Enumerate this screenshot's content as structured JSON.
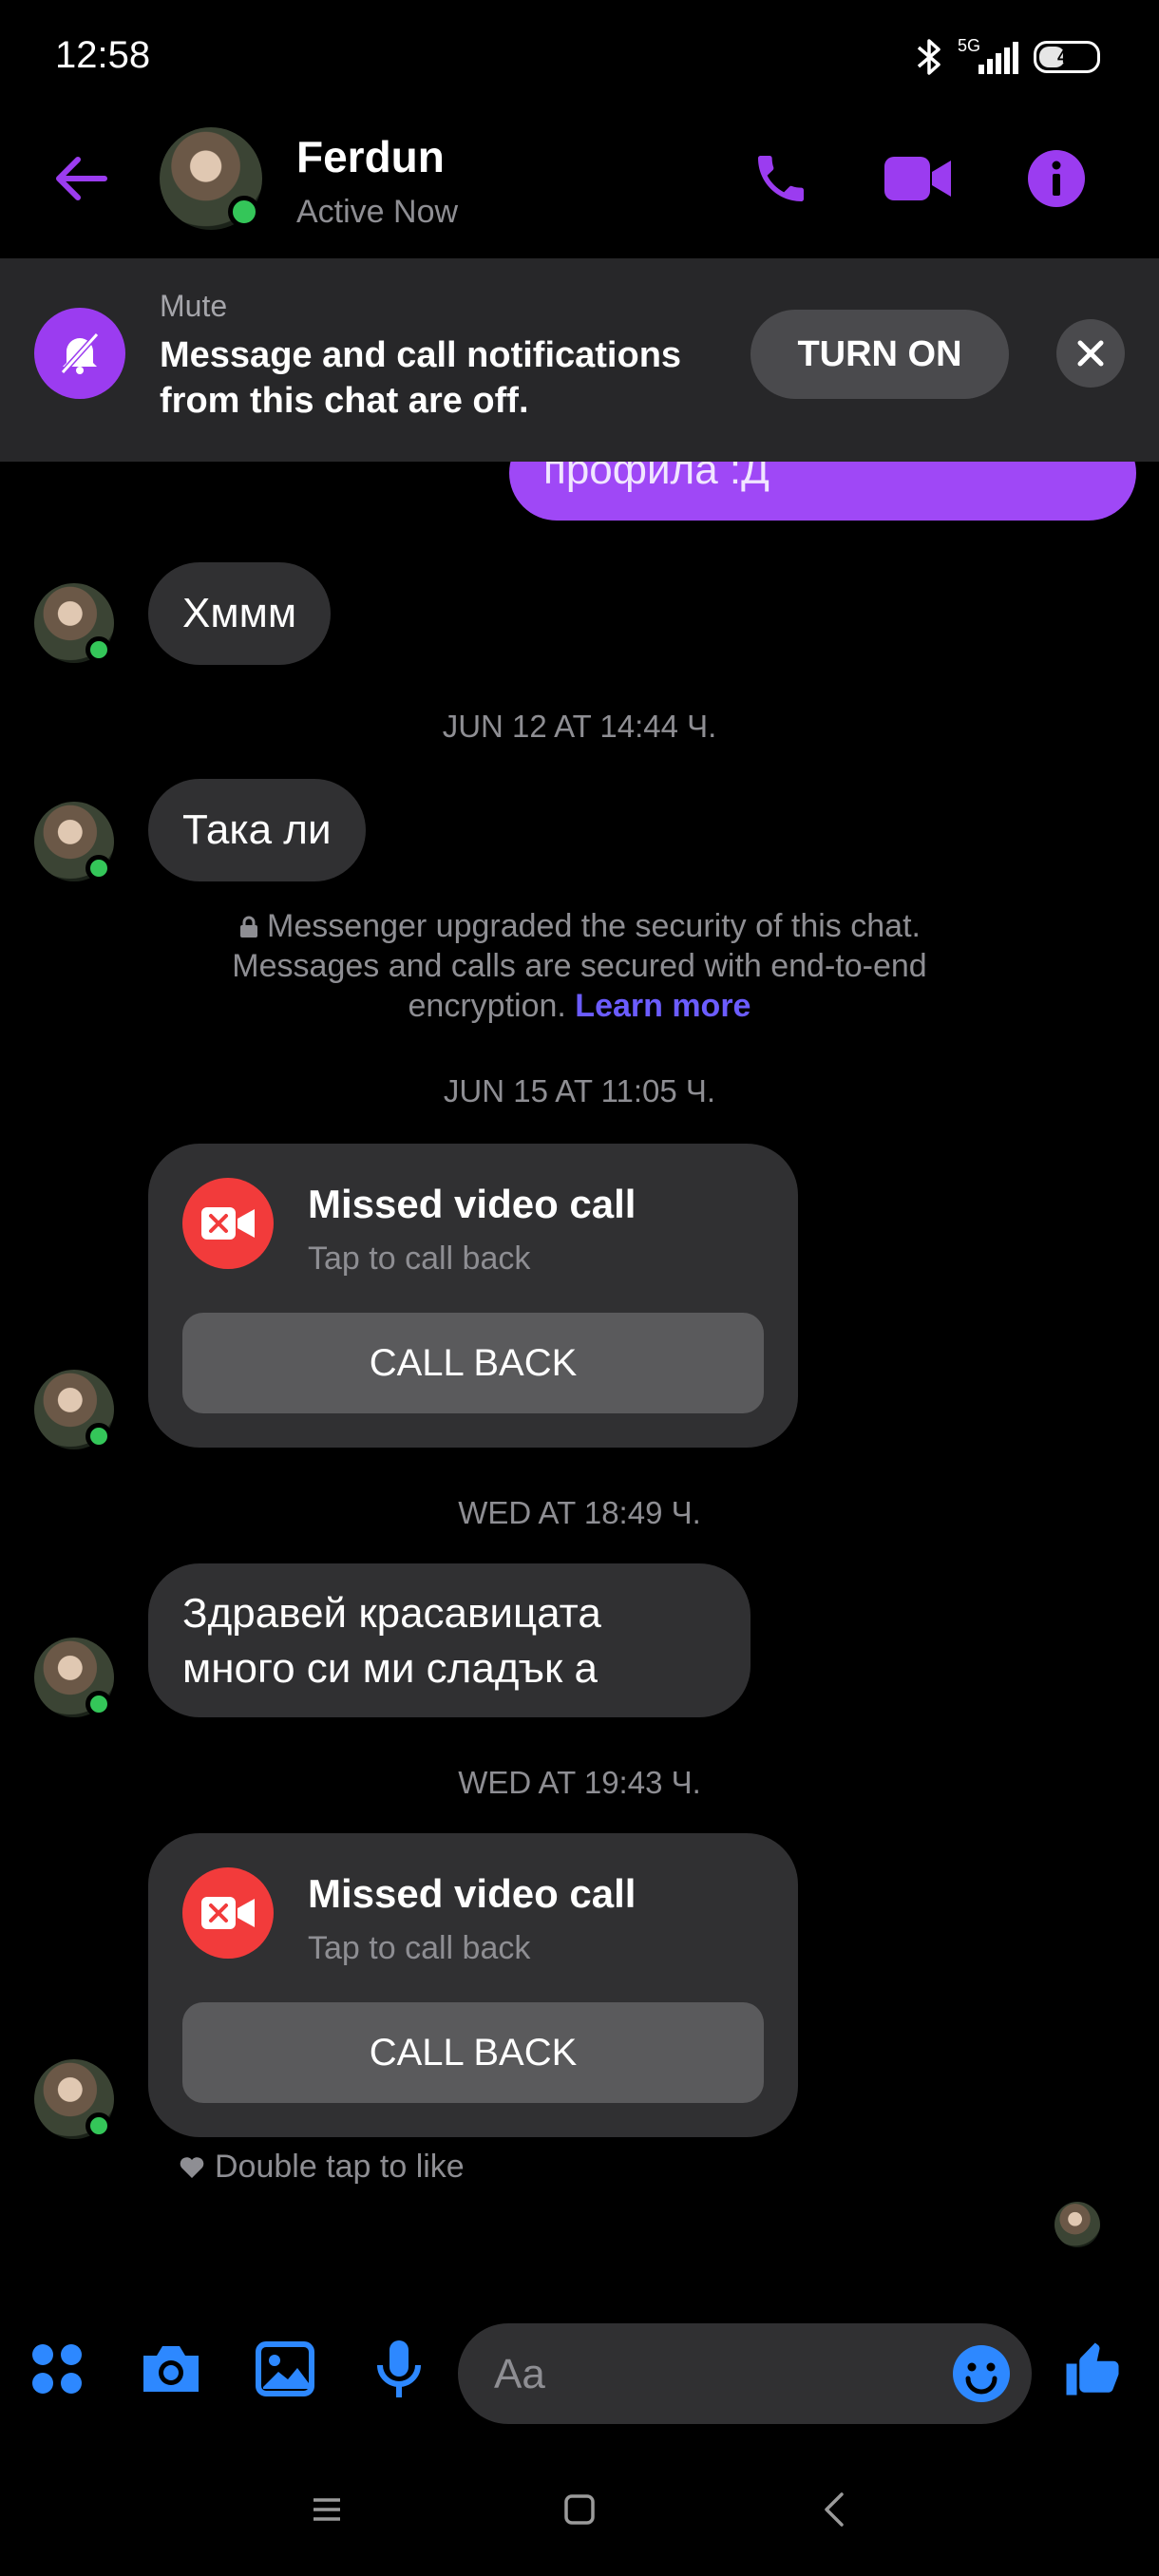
{
  "status_bar": {
    "time": "12:58",
    "network": "5G",
    "battery": "49"
  },
  "header": {
    "name": "Ferdun",
    "status": "Active Now"
  },
  "mute_banner": {
    "title": "Mute",
    "text": "Message and call notifications from this chat are off.",
    "turn_on_label": "TURN ON"
  },
  "messages": {
    "outgoing_partial": "профила :Д",
    "msg1": "Хммм",
    "ts1": "JUN 12 AT 14:44 Ч.",
    "msg2": "Така ли",
    "security_text": "Messenger upgraded the security of this chat. Messages and calls are secured with end-to-end encryption.",
    "learn_more": "Learn more",
    "ts2": "JUN 15 AT 11:05 Ч.",
    "call1": {
      "title": "Missed video call",
      "subtitle": "Tap to call back",
      "button": "CALL BACK"
    },
    "ts3": "WED AT 18:49 Ч.",
    "msg3": "Здравей красавицата много си ми сладък а",
    "ts4": "WED AT 19:43 Ч.",
    "call2": {
      "title": "Missed video call",
      "subtitle": "Tap to call back",
      "button": "CALL BACK"
    },
    "double_tap": "Double tap to like"
  },
  "composer": {
    "placeholder": "Aa"
  },
  "colors": {
    "accent": "#9b3cf0",
    "composer_blue": "#2d88ff",
    "online": "#34c659",
    "missed_call": "#f23b3b"
  }
}
